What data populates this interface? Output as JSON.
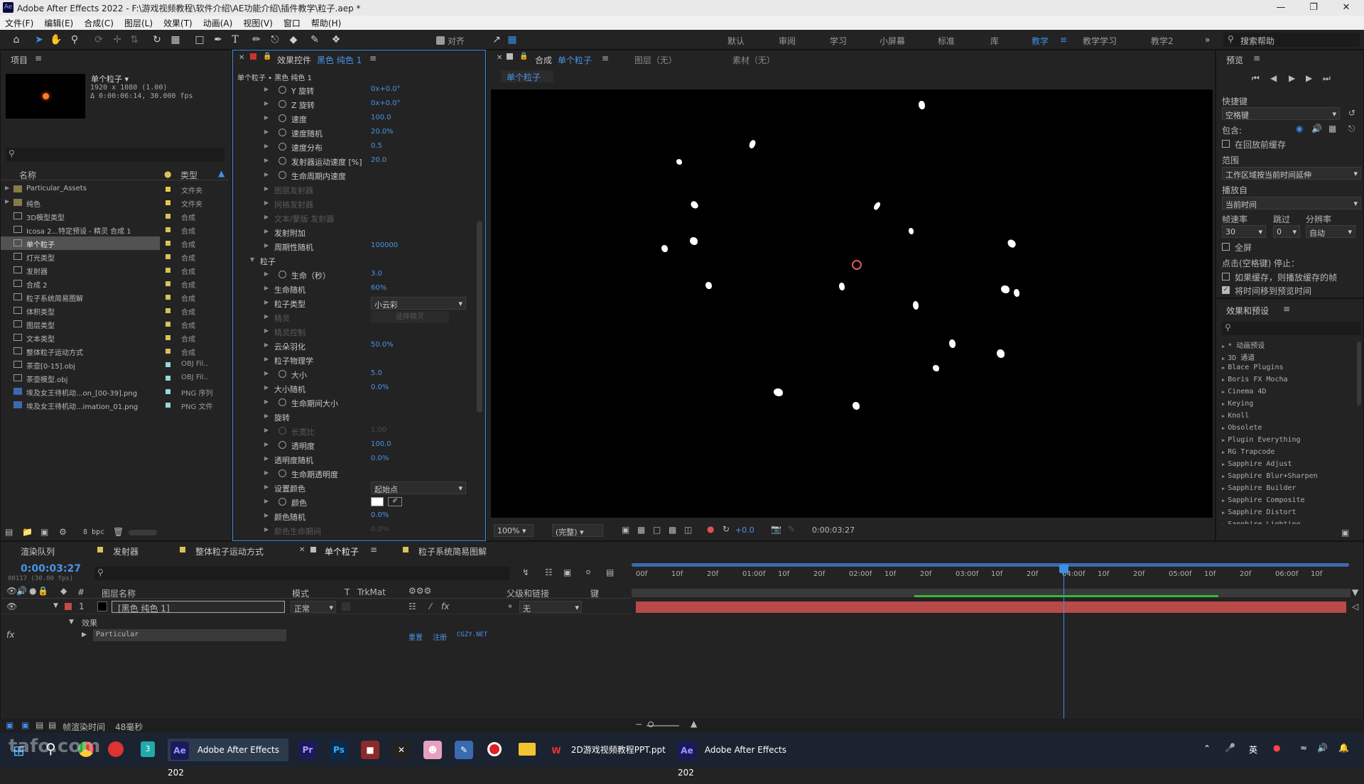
{
  "window": {
    "title": "Adobe After Effects 2022 - F:\\游戏视频教程\\软件介绍\\AE功能介绍\\插件教学\\粒子.aep *"
  },
  "menu": [
    "文件(F)",
    "编辑(E)",
    "合成(C)",
    "图层(L)",
    "效果(T)",
    "动画(A)",
    "视图(V)",
    "窗口",
    "帮助(H)"
  ],
  "toolbar": {
    "snap_label": "对齐"
  },
  "workspaces": [
    "默认",
    "审阅",
    "学习",
    "小屏幕",
    "标准",
    "库",
    "教学",
    "教学学习",
    "教学2"
  ],
  "active_workspace": "教学",
  "search_help": "搜索帮助",
  "project": {
    "tab": "项目",
    "item_name": "单个粒子 ▾",
    "item_size": "1920 x 1080 (1.00)",
    "item_duration": "Δ 0:00:06:14, 30.000 fps",
    "col_name": "名称",
    "col_type": "类型",
    "bpc": "8 bpc",
    "items": [
      {
        "name": "Particular_Assets",
        "type": "文件夹",
        "color": "#e4c84a",
        "kind": "folder"
      },
      {
        "name": "纯色",
        "type": "文件夹",
        "color": "#e4c84a",
        "kind": "folder"
      },
      {
        "name": "3D模型类型",
        "type": "合成",
        "color": "#d9c25a",
        "kind": "comp"
      },
      {
        "name": "Icosa 2...特定预设 - 精灵 合成 1",
        "type": "合成",
        "color": "#d9c25a",
        "kind": "comp"
      },
      {
        "name": "单个粒子",
        "type": "合成",
        "color": "#d9c25a",
        "kind": "comp",
        "selected": true
      },
      {
        "name": "灯光类型",
        "type": "合成",
        "color": "#d9c25a",
        "kind": "comp"
      },
      {
        "name": "发射器",
        "type": "合成",
        "color": "#d9c25a",
        "kind": "comp"
      },
      {
        "name": "合成 2",
        "type": "合成",
        "color": "#d9c25a",
        "kind": "comp"
      },
      {
        "name": "粒子系统简易图解",
        "type": "合成",
        "color": "#d9c25a",
        "kind": "comp"
      },
      {
        "name": "体积类型",
        "type": "合成",
        "color": "#d9c25a",
        "kind": "comp"
      },
      {
        "name": "图层类型",
        "type": "合成",
        "color": "#d9c25a",
        "kind": "comp"
      },
      {
        "name": "文本类型",
        "type": "合成",
        "color": "#d9c25a",
        "kind": "comp"
      },
      {
        "name": "整体粒子运动方式",
        "type": "合成",
        "color": "#d9c25a",
        "kind": "comp"
      },
      {
        "name": "茶壶[0-15].obj",
        "type": "OBJ Fil..",
        "color": "#9ad6d6",
        "kind": "file"
      },
      {
        "name": "茶壶模型.obj",
        "type": "OBJ Fil..",
        "color": "#9ad6d6",
        "kind": "file"
      },
      {
        "name": "埃及女王待机动...on_[00-39].png",
        "type": "PNG 序列",
        "color": "#9ad6d6",
        "kind": "seq"
      },
      {
        "name": "埃及女王待机动...imation_01.png",
        "type": "PNG 文件",
        "color": "#9ad6d6",
        "kind": "seq"
      }
    ]
  },
  "effects": {
    "tab_label": "效果控件",
    "tab_target": "黑色 纯色 1",
    "breadcrumb": "单个粒子 • 黑色 纯色 1",
    "rows": [
      {
        "label": "Y 旋转",
        "value": "0x+0.0°",
        "indent": 2,
        "stopwatch": true
      },
      {
        "label": "Z 旋转",
        "value": "0x+0.0°",
        "indent": 2,
        "stopwatch": true
      },
      {
        "label": "速度",
        "value": "100.0",
        "indent": 2,
        "stopwatch": true
      },
      {
        "label": "速度随机",
        "value": "20.0%",
        "indent": 2,
        "stopwatch": true
      },
      {
        "label": "速度分布",
        "value": "0.5",
        "indent": 2,
        "stopwatch": true
      },
      {
        "label": "发射器运动速度 [%]",
        "value": "20.0",
        "indent": 2,
        "stopwatch": true
      },
      {
        "label": "生命周期内速度",
        "value": "",
        "indent": 2,
        "stopwatch": true
      },
      {
        "label": "图层发射器",
        "value": "",
        "indent": 1,
        "dim": true
      },
      {
        "label": "网格发射器",
        "value": "",
        "indent": 1,
        "dim": true
      },
      {
        "label": "文本/蒙版 发射器",
        "value": "",
        "indent": 1,
        "dim": true
      },
      {
        "label": "发射附加",
        "value": "",
        "indent": 1
      },
      {
        "label": "周期性随机",
        "value": "100000",
        "indent": 1
      },
      {
        "label": "粒子",
        "value": "",
        "indent": 0,
        "open": true
      },
      {
        "label": "生命（秒）",
        "value": "3.0",
        "indent": 2,
        "stopwatch": true
      },
      {
        "label": "生命随机",
        "value": "60%",
        "indent": 1
      },
      {
        "label": "粒子类型",
        "value": "",
        "indent": 1,
        "dropdown": "小云彩"
      },
      {
        "label": "精灵",
        "value": "",
        "indent": 1,
        "dim": true,
        "button": "选择精灵"
      },
      {
        "label": "精灵控制",
        "value": "",
        "indent": 1,
        "dim": true
      },
      {
        "label": "云朵羽化",
        "value": "50.0%",
        "indent": 1
      },
      {
        "label": "粒子物理学",
        "value": "",
        "indent": 1
      },
      {
        "label": "大小",
        "value": "5.0",
        "indent": 2,
        "stopwatch": true
      },
      {
        "label": "大小随机",
        "value": "0.0%",
        "indent": 1
      },
      {
        "label": "生命期间大小",
        "value": "",
        "indent": 2,
        "stopwatch": true
      },
      {
        "label": "旋转",
        "value": "",
        "indent": 1
      },
      {
        "label": "长宽比",
        "value": "1.00",
        "indent": 2,
        "stopwatch": true,
        "dim": true
      },
      {
        "label": "透明度",
        "value": "100.0",
        "indent": 2,
        "stopwatch": true
      },
      {
        "label": "透明度随机",
        "value": "0.0%",
        "indent": 1
      },
      {
        "label": "生命期透明度",
        "value": "",
        "indent": 2,
        "stopwatch": true
      },
      {
        "label": "设置颜色",
        "value": "",
        "indent": 1,
        "dropdown": "起始点"
      },
      {
        "label": "颜色",
        "value": "",
        "indent": 2,
        "stopwatch": true,
        "swatch": "#ffffff"
      },
      {
        "label": "颜色随机",
        "value": "0.0%",
        "indent": 1
      },
      {
        "label": "颜色生命期间",
        "value": "0.0%",
        "indent": 1,
        "dim": true
      }
    ]
  },
  "comp": {
    "tab_prefix": "合成",
    "tab_name": "单个粒子",
    "layer_tab": "图层（无）",
    "footage_tab": "素材（无）",
    "subtab": "单个粒子",
    "zoom": "100%",
    "quality": "(完整)",
    "exposure": "+0.0",
    "timecode": "0:00:03:27"
  },
  "preview": {
    "title": "预览",
    "shortcut_label": "快捷键",
    "shortcut_value": "空格键",
    "include_label": "包含:",
    "cache_label": "在回放前缓存",
    "range_label": "范围",
    "range_value": "工作区域按当前时间延伸",
    "play_from_label": "播放自",
    "play_from_value": "当前时间",
    "fps_label": "帧速率",
    "skip_label": "跳过",
    "res_label": "分辨率",
    "fps_value": "30",
    "skip_value": "0",
    "res_value": "自动",
    "fullscreen_label": "全屏",
    "stop_label": "点击(空格键) 停止：",
    "opt1": "如果缓存，则播放缓存的帧",
    "opt2": "将时间移到预览时间"
  },
  "effects_presets": {
    "title": "效果和预设",
    "items": [
      "* 动画预设",
      "3D 通道",
      "Blace Plugins",
      "Boris FX Mocha",
      "Cinema 4D",
      "Keying",
      "Knoll",
      "Obsolete",
      "Plugin Everything",
      "RG Trapcode",
      "Sapphire Adjust",
      "Sapphire Blur+Sharpen",
      "Sapphire Builder",
      "Sapphire Composite",
      "Sapphire Distort",
      "Sapphire Lighting"
    ]
  },
  "timeline": {
    "tabs": [
      "渲染队列",
      "发射器",
      "整体粒子运动方式",
      "单个粒子",
      "粒子系统简易图解"
    ],
    "active_tab": "单个粒子",
    "timecode": "0:00:03:27",
    "frame_info": "00117 (30.00 fps)",
    "col_layer": "图层名称",
    "col_mode": "模式",
    "col_t": "T",
    "col_trkmat": "TrkMat",
    "col_parent": "父级和链接",
    "col_keys": "键",
    "layer_num": "1",
    "layer_name": "[黑色 纯色 1]",
    "layer_mode": "正常",
    "layer_parent": "无",
    "effects_group": "效果",
    "effect_name": "Particular",
    "effect_links": [
      "重置",
      "注册",
      "CGZY.NET"
    ],
    "ruler": [
      "00f",
      "10f",
      "20f",
      "01:00f",
      "10f",
      "20f",
      "02:00f",
      "10f",
      "20f",
      "03:00f",
      "10f",
      "20f",
      "04:00f",
      "10f",
      "20f",
      "05:00f",
      "10f",
      "20f",
      "06:00f",
      "10f"
    ],
    "playhead_time": "03:27",
    "render_time_label": "帧渲染时间",
    "render_time_value": "48毫秒"
  },
  "taskbar": {
    "ae1": "Adobe After Effects 202",
    "ppt": "2D游戏视频教程PPT.ppt",
    "ae2": "Adobe After Effects 202",
    "ime": "英",
    "watermark": "tafo.com"
  }
}
